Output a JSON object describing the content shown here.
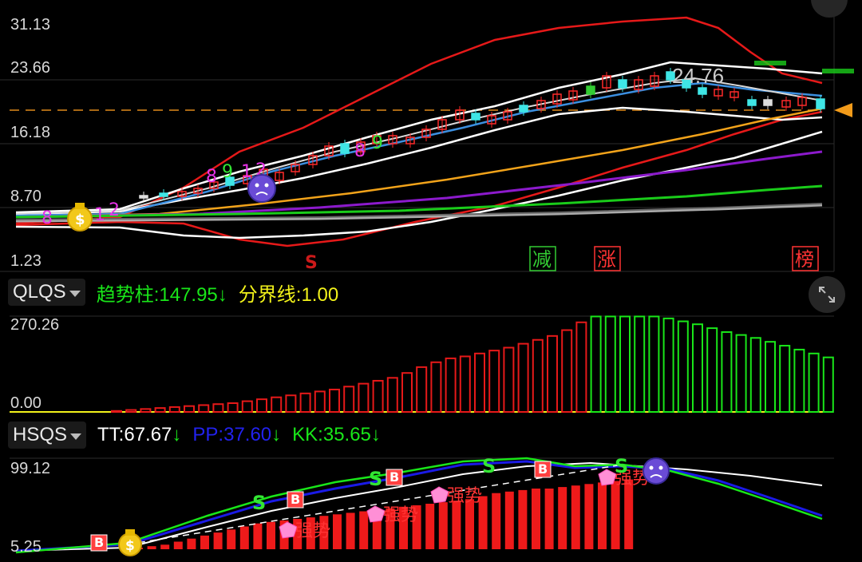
{
  "main_chart": {
    "y_labels": [
      "31.13",
      "23.66",
      "16.18",
      "8.70",
      "1.23"
    ],
    "price_annotation": "24.76",
    "signal_s": "S",
    "markers": [
      "减",
      "涨",
      "榜"
    ],
    "seq_numbers": [
      "8",
      "1",
      "2",
      "8",
      "9",
      "1",
      "2",
      "8",
      "9"
    ]
  },
  "qlqs": {
    "indicator": "QLQS",
    "trend_label": "趋势柱:",
    "trend_value": "147.95",
    "boundary_label": "分界线:",
    "boundary_value": "1.00",
    "y_top": "270.26",
    "y_bottom": "0.00",
    "colors": {
      "trend": "#19e619",
      "boundary": "#f2f21a"
    }
  },
  "hsqs": {
    "indicator": "HSQS",
    "tt_label": "TT:",
    "tt_value": "67.67",
    "pp_label": "PP:",
    "pp_value": "37.60",
    "kk_label": "KK:",
    "kk_value": "35.65",
    "y_top": "99.12",
    "y_bottom": "5.25",
    "strong_label": "强势",
    "s_label": "S",
    "b_label": "B",
    "colors": {
      "tt": "#ffffff",
      "pp": "#1a1ae6",
      "kk": "#19e619"
    }
  },
  "icons": [
    "expand-icon",
    "money-bag-icon",
    "sad-face-icon"
  ]
}
